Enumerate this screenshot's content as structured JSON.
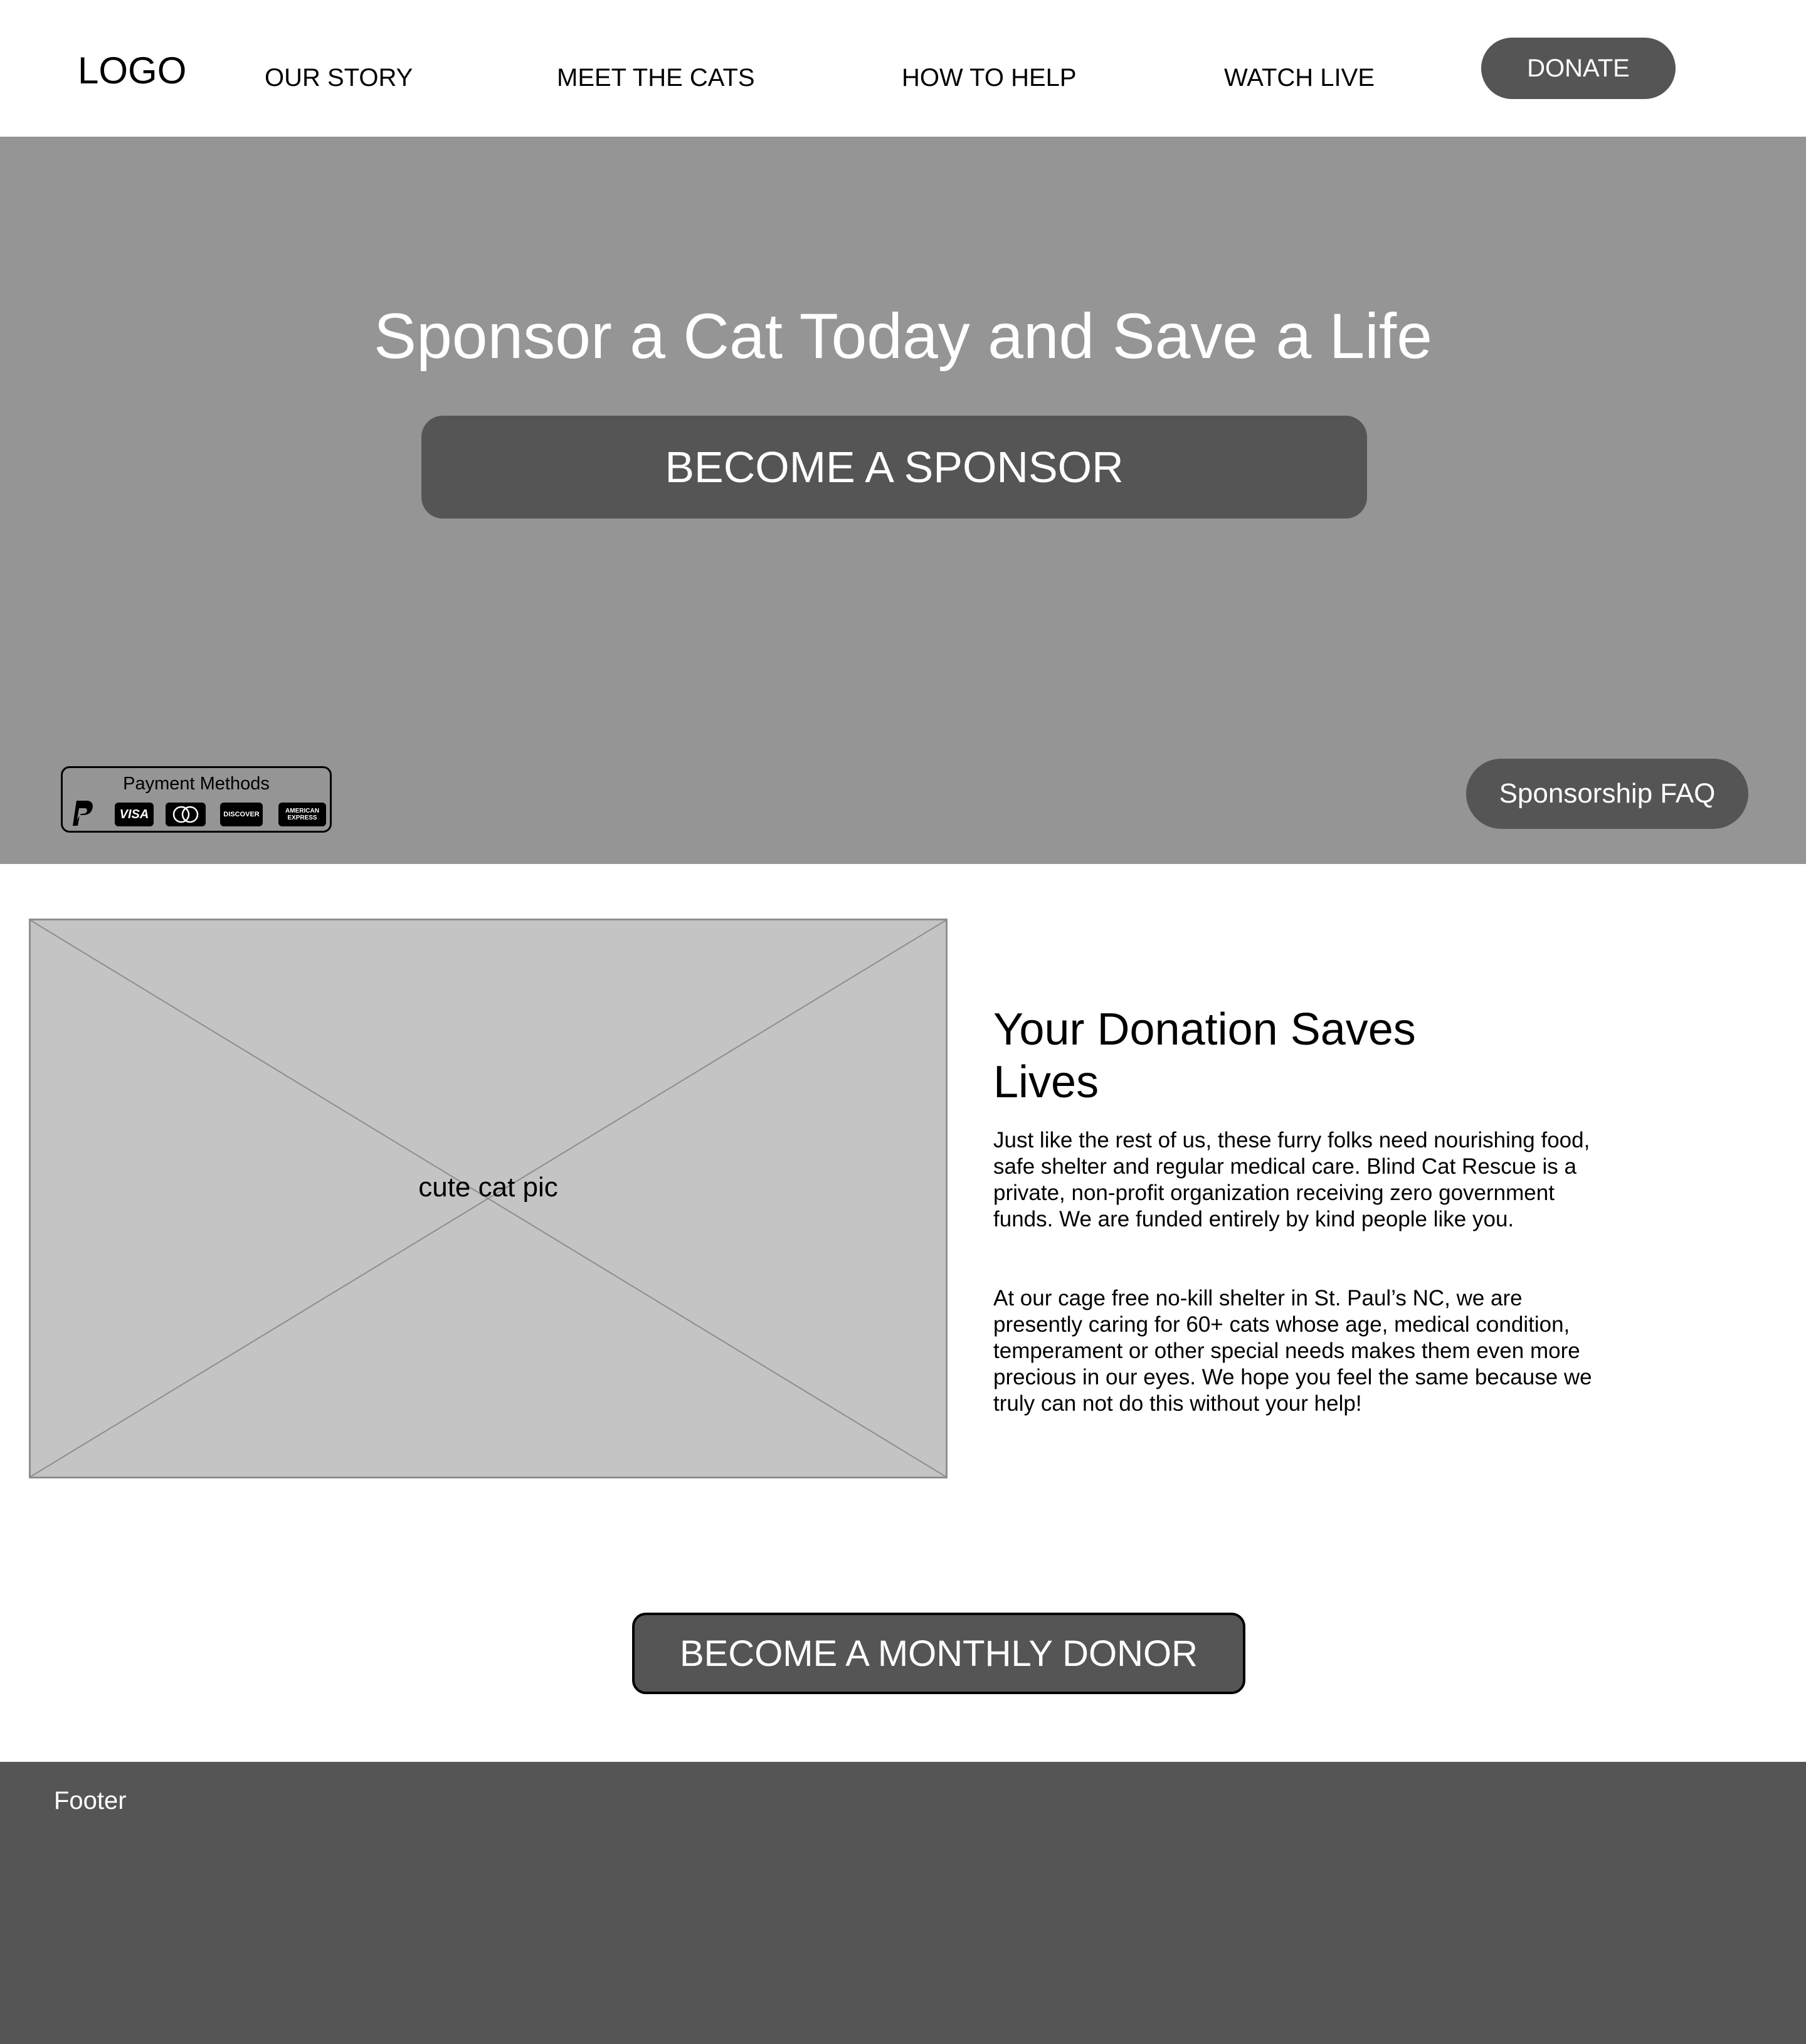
{
  "nav": {
    "logo": "LOGO",
    "links": [
      "OUR STORY",
      "MEET THE CATS",
      "HOW TO HELP",
      "WATCH LIVE"
    ],
    "donate_label": "DONATE"
  },
  "hero": {
    "title": "Sponsor a Cat Today and Save a Life",
    "cta_label": "BECOME A SPONSOR",
    "payment": {
      "title": "Payment Methods",
      "methods": [
        "paypal-icon",
        "visa-icon",
        "mastercard-icon",
        "discover-icon",
        "amex-icon"
      ]
    },
    "faq_label": "Sponsorship FAQ"
  },
  "content": {
    "image_label": "cute cat pic",
    "title": "Your Donation Saves Lives",
    "paragraphs": [
      "Just like the rest of us, these furry folks need nourishing food, safe shelter and regular medical care.  Blind Cat Rescue is a private, non-profit organization receiving zero government funds.  We are funded entirely by kind people like you.",
      "At our cage free no-kill shelter in St. Paul’s NC, we are presently caring for 60+ cats whose age, medical condition, temperament or other special needs makes them even more precious in our eyes.  We hope you feel the same because we truly can not do this without your help!"
    ],
    "monthly_cta_label": "BECOME A MONTHLY DONOR"
  },
  "footer": {
    "label": "Footer"
  },
  "colors": {
    "hero_bg": "#959595",
    "button_bg": "#555555",
    "placeholder_bg": "#c4c4c4",
    "footer_bg": "#555555"
  }
}
